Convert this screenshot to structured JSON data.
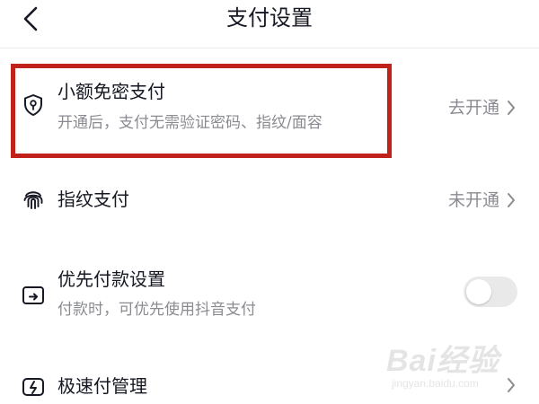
{
  "header": {
    "title": "支付设置",
    "back_icon": "back-arrow-icon"
  },
  "rows": [
    {
      "icon": "shield-lock-icon",
      "title": "小额免密支付",
      "subtitle": "开通后，支付无需验证密码、指纹/面容",
      "action": "去开通",
      "highlighted": true
    },
    {
      "icon": "fingerprint-icon",
      "title": "指纹支付",
      "action": "未开通"
    },
    {
      "icon": "card-priority-icon",
      "title": "优先付款设置",
      "subtitle": "付款时，可优先使用抖音支付",
      "toggle_on": false
    },
    {
      "icon": "fast-pay-icon",
      "title": "极速付管理"
    }
  ],
  "watermark": {
    "logo": "Bai经验",
    "url": "jingyan.baidu.com"
  },
  "colors": {
    "highlight": "#c0211b",
    "text_primary": "#161823",
    "text_secondary": "#8a8b91",
    "toggle_off": "#e9e9ea"
  }
}
